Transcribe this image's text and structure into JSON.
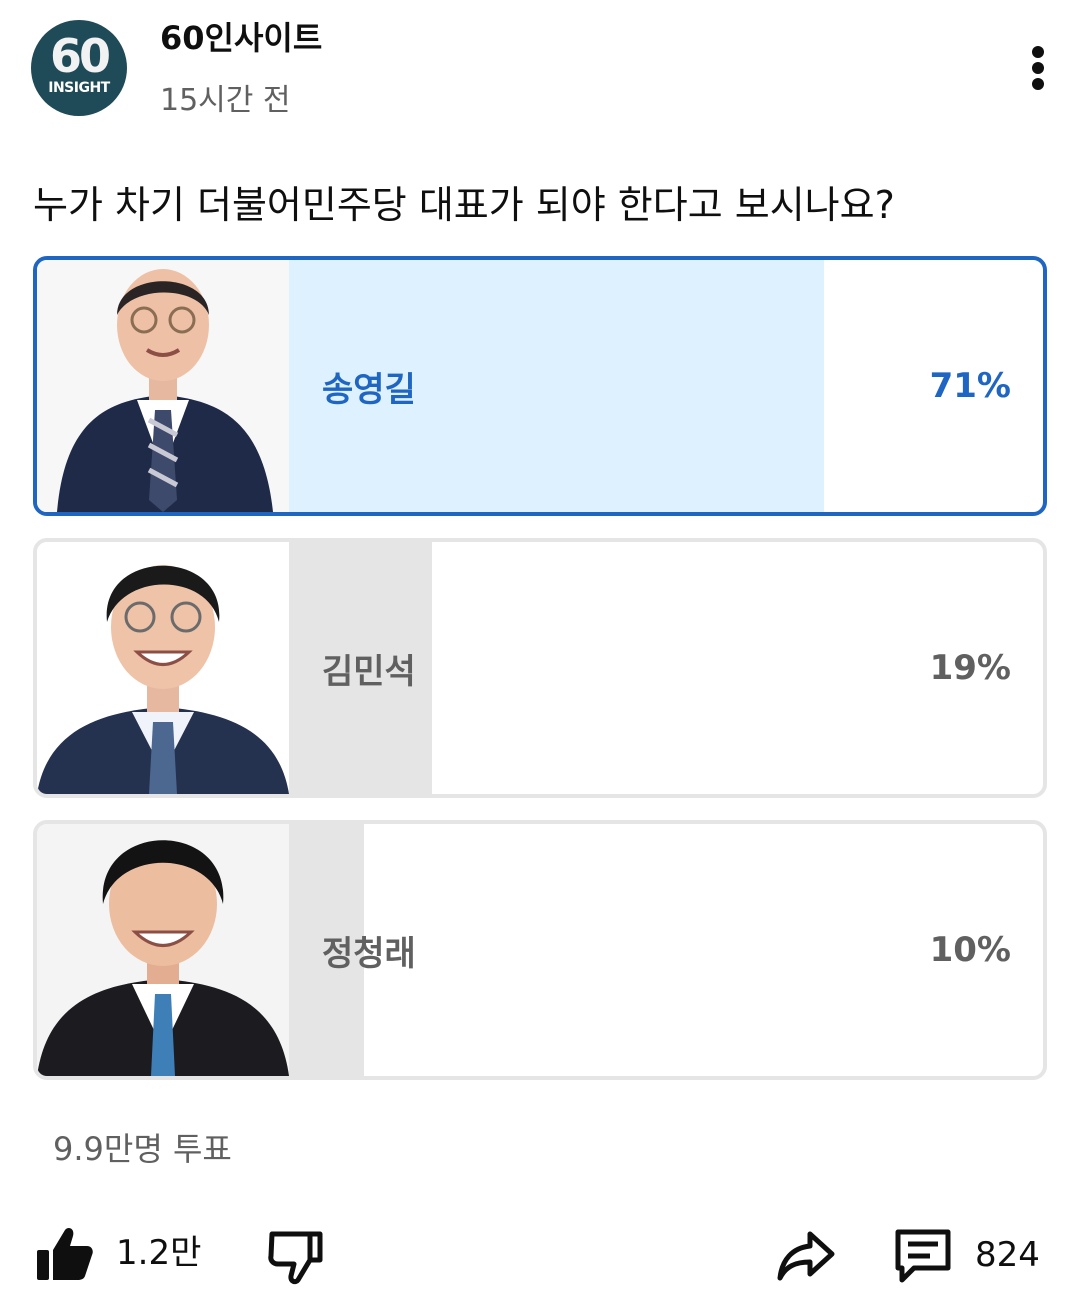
{
  "channel": {
    "avatar_number": "60",
    "avatar_sub": "INSIGHT",
    "name": "60인사이트",
    "time_ago": "15시간 전"
  },
  "poll": {
    "question": "누가 차기 더불어민주당 대표가 되야 한다고 보시나요?",
    "options": [
      {
        "label": "송영길",
        "percent": "71%",
        "fraction": 0.71,
        "selected": true
      },
      {
        "label": "김민석",
        "percent": "19%",
        "fraction": 0.19,
        "selected": false
      },
      {
        "label": "정청래",
        "percent": "10%",
        "fraction": 0.1,
        "selected": false
      }
    ],
    "votes": "9.9만명 투표"
  },
  "actions": {
    "like_count": "1.2만",
    "comment_count": "824"
  },
  "icons": [
    "thumbs-up-icon",
    "thumbs-down-icon",
    "share-icon",
    "comment-icon",
    "more-vert-icon"
  ],
  "colors": {
    "accent": "#1f66c2",
    "selected_fill": "#def1ff",
    "bar_fill": "#e5e5e5",
    "muted_text": "#606060"
  }
}
